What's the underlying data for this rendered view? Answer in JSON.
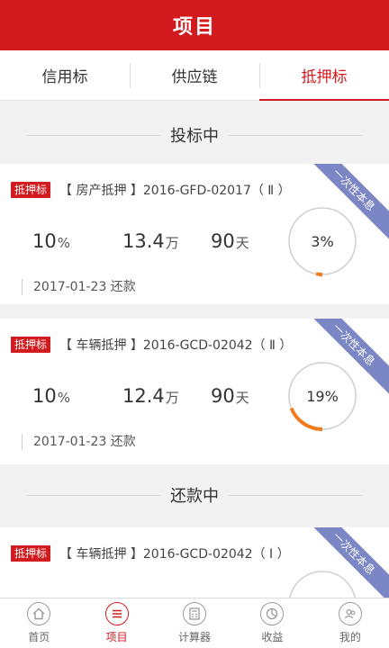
{
  "header": {
    "title": "项目"
  },
  "tabs": [
    {
      "label": "信用标"
    },
    {
      "label": "供应链"
    },
    {
      "label": "抵押标",
      "active": true
    }
  ],
  "sections": [
    {
      "title": "投标中"
    },
    {
      "title": "还款中"
    }
  ],
  "cards": [
    {
      "tag": "抵押标",
      "name": "【 房产抵押 】2016-GFD-02017（ Ⅱ ）",
      "ribbon": "一次性本息",
      "rate": "10",
      "rate_unit": "%",
      "amount": "13.4",
      "amount_unit": "万",
      "term": "90",
      "term_unit": "天",
      "progress": 3,
      "progress_label": "3%",
      "date": "2017-01-23 还款"
    },
    {
      "tag": "抵押标",
      "name": "【 车辆抵押 】2016-GCD-02042（ Ⅱ ）",
      "ribbon": "一次性本息",
      "rate": "10",
      "rate_unit": "%",
      "amount": "12.4",
      "amount_unit": "万",
      "term": "90",
      "term_unit": "天",
      "progress": 19,
      "progress_label": "19%",
      "date": "2017-01-23 还款"
    },
    {
      "tag": "抵押标",
      "name": "【 车辆抵押 】2016-GCD-02042（ Ⅰ ）",
      "ribbon": "一次性本息"
    }
  ],
  "colors": {
    "brand": "#d31a1e",
    "progress": "#f07a1c",
    "ribbon": "#7b86c4"
  },
  "bottom_nav": [
    {
      "label": "首页",
      "icon": "home-icon"
    },
    {
      "label": "项目",
      "icon": "list-icon",
      "active": true
    },
    {
      "label": "计算器",
      "icon": "calculator-icon"
    },
    {
      "label": "收益",
      "icon": "pie-chart-icon"
    },
    {
      "label": "我的",
      "icon": "user-icon"
    }
  ]
}
